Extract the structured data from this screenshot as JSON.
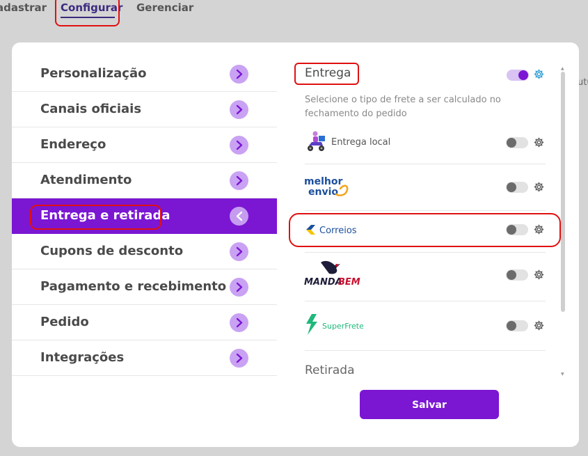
{
  "topnav": {
    "tabs": [
      "Cadastrar",
      "Configurar",
      "Gerenciar"
    ],
    "visible_partial_left": "dastrar"
  },
  "bg_edge_text": "utu",
  "menu": {
    "items": [
      {
        "label": "Personalização",
        "active": false
      },
      {
        "label": "Canais oficiais",
        "active": false
      },
      {
        "label": "Endereço",
        "active": false
      },
      {
        "label": "Atendimento",
        "active": false
      },
      {
        "label": "Entrega e retirada",
        "active": true
      },
      {
        "label": "Cupons de desconto",
        "active": false
      },
      {
        "label": "Pagamento e recebimento",
        "active": false
      },
      {
        "label": "Pedido",
        "active": false
      },
      {
        "label": "Integrações",
        "active": false
      }
    ]
  },
  "entrega": {
    "title": "Entrega",
    "enabled": true,
    "description": "Selecione o tipo de frete a ser calculado no fechamento do pedido",
    "carriers": [
      {
        "name": "Entrega local",
        "logo": "delivery-scooter-icon",
        "enabled": false
      },
      {
        "name": "melhor envio",
        "logo": "melhor-envio-logo",
        "enabled": false
      },
      {
        "name": "Correios",
        "logo": "correios-logo",
        "enabled": false
      },
      {
        "name": "MANDABEM",
        "logo": "mandabem-logo",
        "enabled": false
      },
      {
        "name": "SuperFrete",
        "logo": "superfrete-logo",
        "enabled": false
      }
    ]
  },
  "retirada": {
    "title": "Retirada"
  },
  "actions": {
    "save_label": "Salvar"
  },
  "colors": {
    "accent": "#7b16d3",
    "arrow_bg": "#c9a2f3",
    "annotation": "#e01010"
  }
}
